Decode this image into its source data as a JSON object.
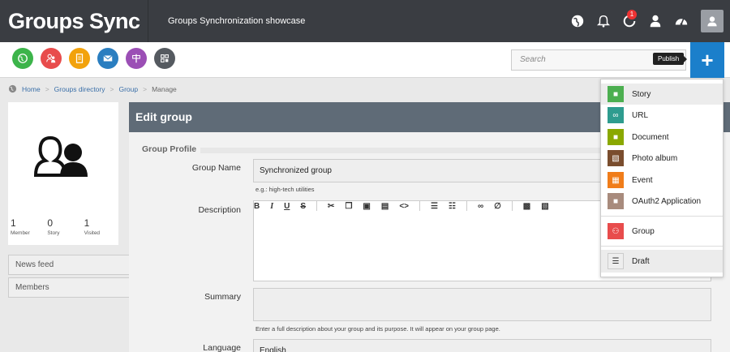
{
  "header": {
    "brand": "Groups Sync",
    "subtitle": "Groups Synchronization showcase",
    "notification_count": "1"
  },
  "search": {
    "placeholder": "Search"
  },
  "publish": {
    "tooltip": "Publish",
    "icon": "+"
  },
  "apps": [
    {
      "name": "globe",
      "color": "#3cb44a"
    },
    {
      "name": "users",
      "color": "#e84c4c"
    },
    {
      "name": "contacts",
      "color": "#f2a20c"
    },
    {
      "name": "mail",
      "color": "#2a7ec0"
    },
    {
      "name": "signpost",
      "color": "#9b4fb5"
    },
    {
      "name": "apps",
      "color": "#555a60"
    }
  ],
  "breadcrumb": {
    "home": "Home",
    "directory": "Groups directory",
    "group": "Group",
    "current": "Manage"
  },
  "profile": {
    "stats": [
      {
        "value": "1",
        "label": "Member"
      },
      {
        "value": "0",
        "label": "Story"
      },
      {
        "value": "1",
        "label": "Visited"
      }
    ]
  },
  "side_links": {
    "news": "News feed",
    "members": "Members"
  },
  "form": {
    "title": "Edit group",
    "section": "Group Profile",
    "group_name_label": "Group Name",
    "group_name_value": "Synchronized group",
    "group_name_hint": "e.g.: high-tech utilities",
    "description_label": "Description",
    "summary_label": "Summary",
    "summary_hint": "Enter a full description about your group and its purpose. It will appear on your group page.",
    "language_label": "Language",
    "language_value": "English"
  },
  "publish_menu": [
    {
      "label": "Story",
      "color": "#4caf50"
    },
    {
      "label": "URL",
      "color": "#2e9c8f"
    },
    {
      "label": "Document",
      "color": "#8aa800"
    },
    {
      "label": "Photo album",
      "color": "#7a4d2e"
    },
    {
      "label": "Event",
      "color": "#f07d1a"
    },
    {
      "label": "OAuth2 Application",
      "color": "#a88b7d"
    },
    {
      "label": "Group",
      "color": "#e84c4c"
    },
    {
      "label": "Draft",
      "color": "#eeeeee"
    }
  ]
}
